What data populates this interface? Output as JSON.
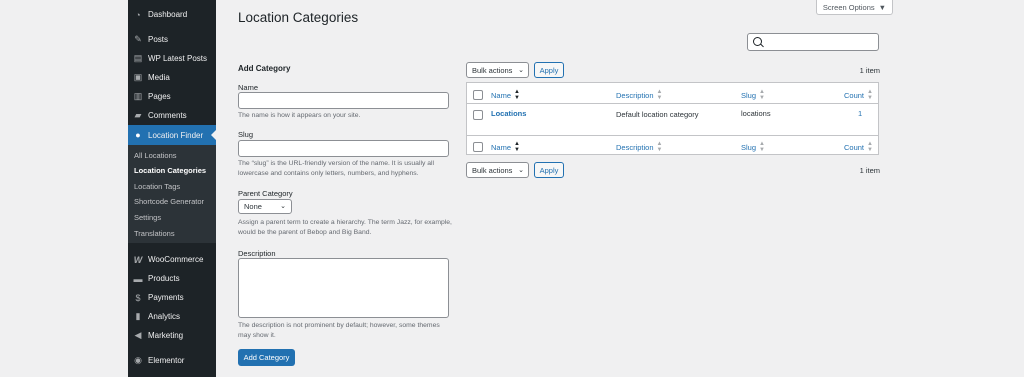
{
  "sidebar": {
    "top_items": [
      {
        "label": "Dashboard",
        "icon": "dashboard-icon"
      },
      {
        "label": "Posts",
        "icon": "pin-icon"
      },
      {
        "label": "WP Latest Posts",
        "icon": "latest-posts-icon"
      },
      {
        "label": "Media",
        "icon": "media-icon"
      },
      {
        "label": "Pages",
        "icon": "pages-icon"
      },
      {
        "label": "Comments",
        "icon": "comments-icon"
      },
      {
        "label": "Location Finder",
        "icon": "location-pin-icon"
      }
    ],
    "submenu": [
      "All Locations",
      "Location Categories",
      "Location Tags",
      "Shortcode Generator",
      "Settings",
      "Translations"
    ],
    "bottom_items": [
      {
        "label": "WooCommerce",
        "icon": "woocommerce-icon"
      },
      {
        "label": "Products",
        "icon": "products-icon"
      },
      {
        "label": "Payments",
        "icon": "payments-icon"
      },
      {
        "label": "Analytics",
        "icon": "analytics-icon"
      },
      {
        "label": "Marketing",
        "icon": "marketing-icon"
      },
      {
        "label": "Elementor",
        "icon": "elementor-icon"
      }
    ],
    "active_color": "#2271b1"
  },
  "header": {
    "title": "Location Categories",
    "screen_options": "Screen Options",
    "search_placeholder": ""
  },
  "form": {
    "title": "Add Category",
    "name_label": "Name",
    "name_help": "The name is how it appears on your site.",
    "slug_label": "Slug",
    "slug_help": "The “slug” is the URL-friendly version of the name. It is usually all lowercase and contains only letters, numbers, and hyphens.",
    "parent_label": "Parent Category",
    "parent_value": "None",
    "parent_help": "Assign a parent term to create a hierarchy. The term Jazz, for example, would be the parent of Bebop and Big Band.",
    "description_label": "Description",
    "description_help": "The description is not prominent by default; however, some themes may show it.",
    "submit": "Add Category"
  },
  "list": {
    "bulk_actions": "Bulk actions",
    "apply": "Apply",
    "count": "1 item",
    "columns": {
      "name": "Name",
      "description": "Description",
      "slug": "Slug",
      "count": "Count"
    },
    "rows": [
      {
        "name": "Locations",
        "description": "Default location category",
        "slug": "locations",
        "count": "1"
      }
    ]
  }
}
